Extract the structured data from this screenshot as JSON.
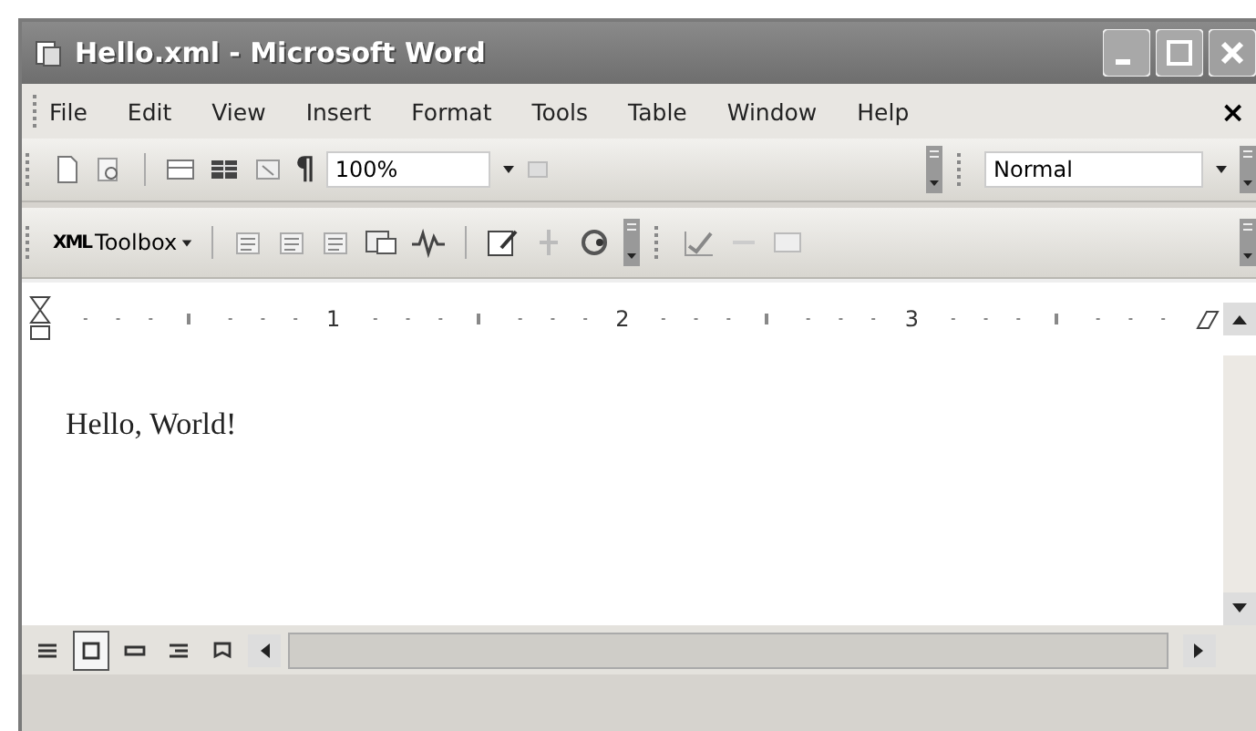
{
  "window": {
    "title": "Hello.xml - Microsoft Word"
  },
  "menu": {
    "items": [
      "File",
      "Edit",
      "View",
      "Insert",
      "Format",
      "Tools",
      "Table",
      "Window",
      "Help"
    ],
    "close": "×"
  },
  "standard_toolbar": {
    "pilcrow": "¶",
    "zoom": "100%",
    "style": "Normal"
  },
  "xml_toolbar": {
    "icon_text": "XML",
    "label": "Toolbox"
  },
  "ruler": {
    "numbers": [
      "1",
      "2",
      "3"
    ]
  },
  "document": {
    "text": "Hello, World!"
  },
  "view_buttons": [
    {
      "selected": false
    },
    {
      "selected": true
    },
    {
      "selected": false
    },
    {
      "selected": false
    },
    {
      "selected": false
    }
  ]
}
